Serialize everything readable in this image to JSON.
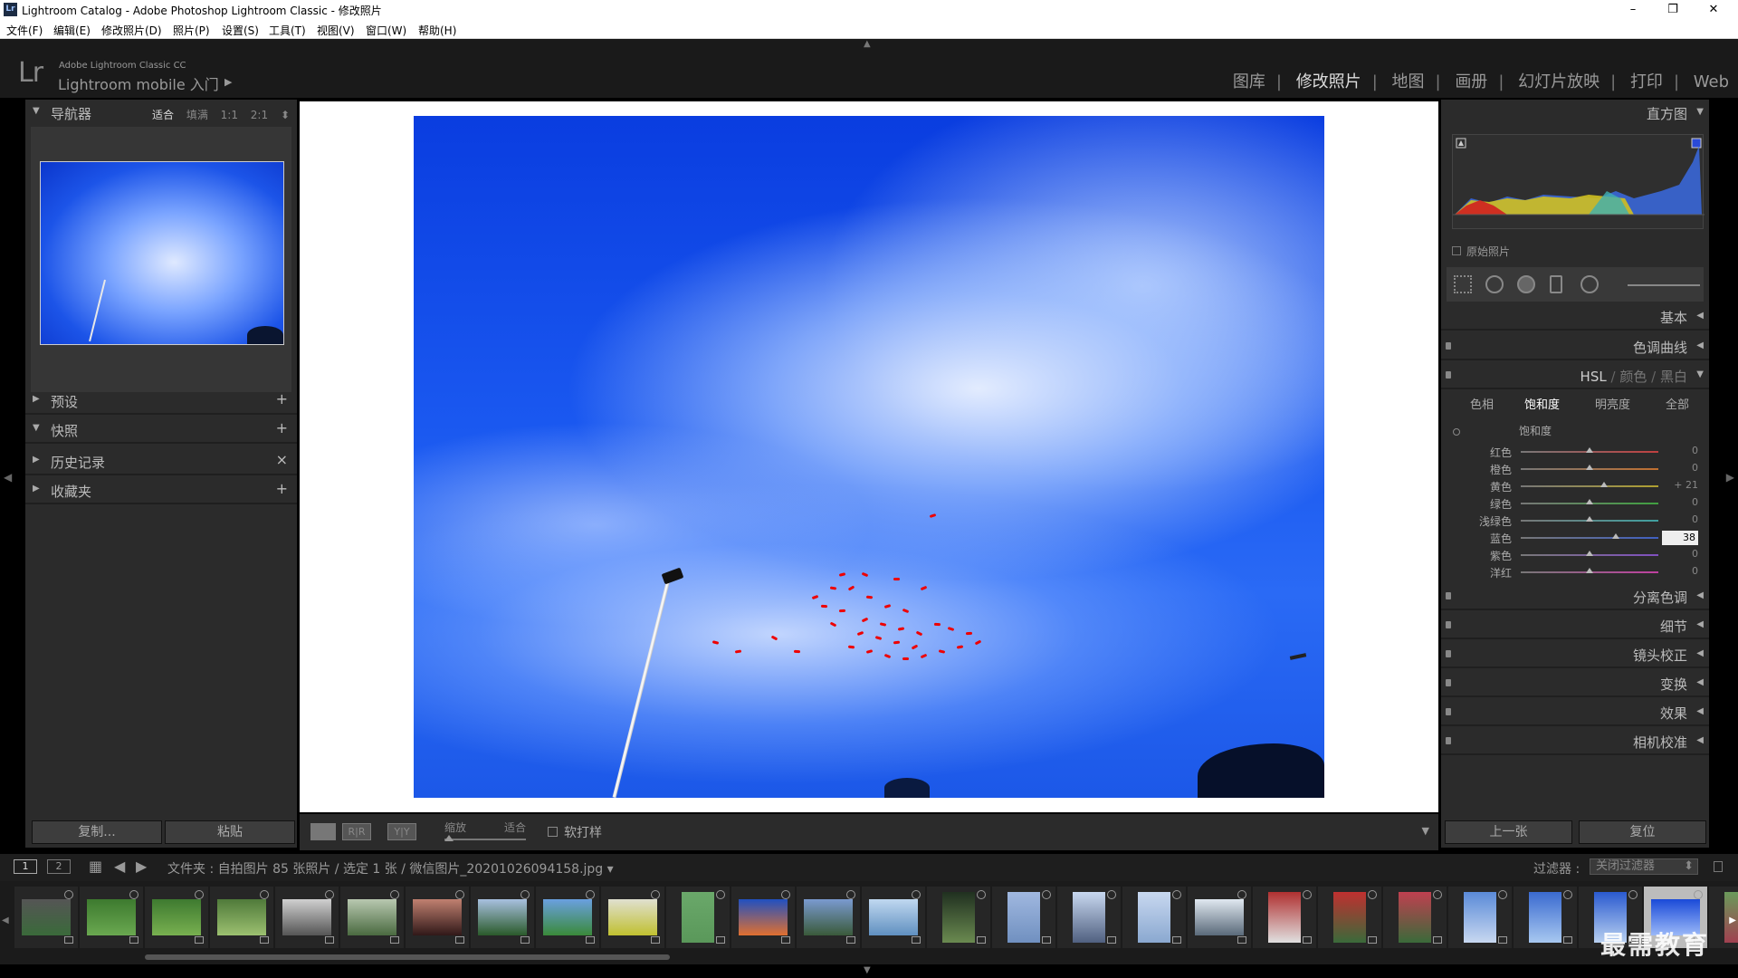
{
  "window": {
    "badge": "Lr",
    "title": "Lightroom Catalog - Adobe Photoshop Lightroom Classic - 修改照片",
    "minimize": "–",
    "restore": "❐",
    "close": "✕"
  },
  "menu": [
    "文件(F)",
    "编辑(E)",
    "修改照片(D)",
    "照片(P)",
    "设置(S)",
    "工具(T)",
    "视图(V)",
    "窗口(W)",
    "帮助(H)"
  ],
  "identity": {
    "logo": "Lr",
    "line1": "Adobe Lightroom Classic CC",
    "line2": "Lightroom mobile 入门",
    "arrow": "▶"
  },
  "modules": [
    "图库",
    "修改照片",
    "地图",
    "画册",
    "幻灯片放映",
    "打印",
    "Web"
  ],
  "active_module": "修改照片",
  "left_panel": {
    "navigator": {
      "title": "导航器",
      "zoom": [
        "适合",
        "填满",
        "1:1",
        "2:1"
      ],
      "zoom_current": "适合",
      "zoom_more": "⬍"
    },
    "sections": [
      {
        "label": "预设",
        "action": "+"
      },
      {
        "label": "快照",
        "action": "+"
      },
      {
        "label": "历史记录",
        "action": "×"
      },
      {
        "label": "收藏夹",
        "action": "+"
      }
    ],
    "copy_button": "复制...",
    "paste_button": "粘贴"
  },
  "toolbar": {
    "zoom_label": "缩放",
    "fit_label": "适合",
    "soft_proof": "软打样",
    "ry_label_1": "R|R",
    "ry_label_2": "Y|Y",
    "menu_arrow": "▼"
  },
  "right_panel": {
    "histogram_title": "直方图",
    "original_photo": "原始照片",
    "panels_top": [
      {
        "label": "基本"
      },
      {
        "label": "色调曲线"
      }
    ],
    "hsl_header": {
      "hsl": "HSL",
      "color": "颜色",
      "bw": "黑白",
      "sep": "/"
    },
    "hsl_tabs": [
      "色相",
      "饱和度",
      "明亮度",
      "全部"
    ],
    "hsl_tab_current": "饱和度",
    "hsl_group_title": "饱和度",
    "hsl_sliders": [
      {
        "name": "红色",
        "value": "0",
        "pos": 0.5,
        "color": "#c04040"
      },
      {
        "name": "橙色",
        "value": "0",
        "pos": 0.5,
        "color": "#c07030"
      },
      {
        "name": "黄色",
        "value": "+ 21",
        "pos": 0.605,
        "color": "#b0a030"
      },
      {
        "name": "绿色",
        "value": "0",
        "pos": 0.5,
        "color": "#40a040"
      },
      {
        "name": "浅绿色",
        "value": "0",
        "pos": 0.5,
        "color": "#40a0a0"
      },
      {
        "name": "蓝色",
        "value": "38",
        "pos": 0.69,
        "color": "#4060c0"
      },
      {
        "name": "紫色",
        "value": "0",
        "pos": 0.5,
        "color": "#8050c0"
      },
      {
        "name": "洋红",
        "value": "0",
        "pos": 0.5,
        "color": "#c040a0"
      }
    ],
    "panels_bottom": [
      {
        "label": "分离色调"
      },
      {
        "label": "细节"
      },
      {
        "label": "镜头校正"
      },
      {
        "label": "变换"
      },
      {
        "label": "效果"
      },
      {
        "label": "相机校准"
      }
    ],
    "prev_button": "上一张",
    "reset_button": "复位"
  },
  "filmbar": {
    "page1": "1",
    "page2": "2",
    "source": "文件夹 : 自拍图片    85 张照片 / 选定 1 张 / 微信图片_20201026094158.jpg",
    "source_caret": "▾",
    "filter_label": "过滤器 :",
    "filter_value": "关闭过滤器",
    "filter_caret": "⬍"
  },
  "filmstrip": {
    "selected_index": 25,
    "thumbs": [
      {
        "c1": "#555",
        "c2": "#3a6a3a",
        "p": false
      },
      {
        "c1": "#3d7a2f",
        "c2": "#6aa850",
        "p": false
      },
      {
        "c1": "#3e7a30",
        "c2": "#78b050",
        "p": false
      },
      {
        "c1": "#4f7a3a",
        "c2": "#9cc070",
        "p": false
      },
      {
        "c1": "#d0d0d0",
        "c2": "#555",
        "p": false
      },
      {
        "c1": "#b8c8b0",
        "c2": "#4a6a40",
        "p": false
      },
      {
        "c1": "#c08070",
        "c2": "#301818",
        "p": false
      },
      {
        "c1": "#a8c0e0",
        "c2": "#2a5a2a",
        "p": false
      },
      {
        "c1": "#6aa0e0",
        "c2": "#3a8a3a",
        "p": false
      },
      {
        "c1": "#e0e0d0",
        "c2": "#c0c030",
        "p": false
      },
      {
        "c1": "#6aa86a",
        "c2": "#5a985a",
        "p": true
      },
      {
        "c1": "#2050c0",
        "c2": "#e07030",
        "p": false
      },
      {
        "c1": "#7a9ad0",
        "c2": "#3a5a3a",
        "p": false
      },
      {
        "c1": "#c0d8f0",
        "c2": "#6090c0",
        "p": false
      },
      {
        "c1": "#203020",
        "c2": "#6a8a50",
        "p": true
      },
      {
        "c1": "#a0b8e0",
        "c2": "#7090c0",
        "p": true
      },
      {
        "c1": "#c8d8f0",
        "c2": "#506080",
        "p": true
      },
      {
        "c1": "#c8d8f0",
        "c2": "#8aa8d0",
        "p": true
      },
      {
        "c1": "#e0e8f0",
        "c2": "#5a6a7a",
        "p": false
      },
      {
        "c1": "#b03030",
        "c2": "#e0e0e0",
        "p": true
      },
      {
        "c1": "#c03030",
        "c2": "#3a6a3a",
        "p": true
      },
      {
        "c1": "#c04050",
        "c2": "#3a6a3a",
        "p": true
      },
      {
        "c1": "#5a8ad8",
        "c2": "#c8d8f0",
        "p": true
      },
      {
        "c1": "#3a6ad0",
        "c2": "#a8c8f0",
        "p": true
      },
      {
        "c1": "#2a5ad0",
        "c2": "#b8d0f0",
        "p": true
      },
      {
        "c1": "#1a4ad8",
        "c2": "#9ab8f8",
        "p": false
      },
      {
        "c1": "#6a9a5a",
        "c2": "#a04050",
        "p": true
      }
    ]
  },
  "watermark": "最需教育"
}
